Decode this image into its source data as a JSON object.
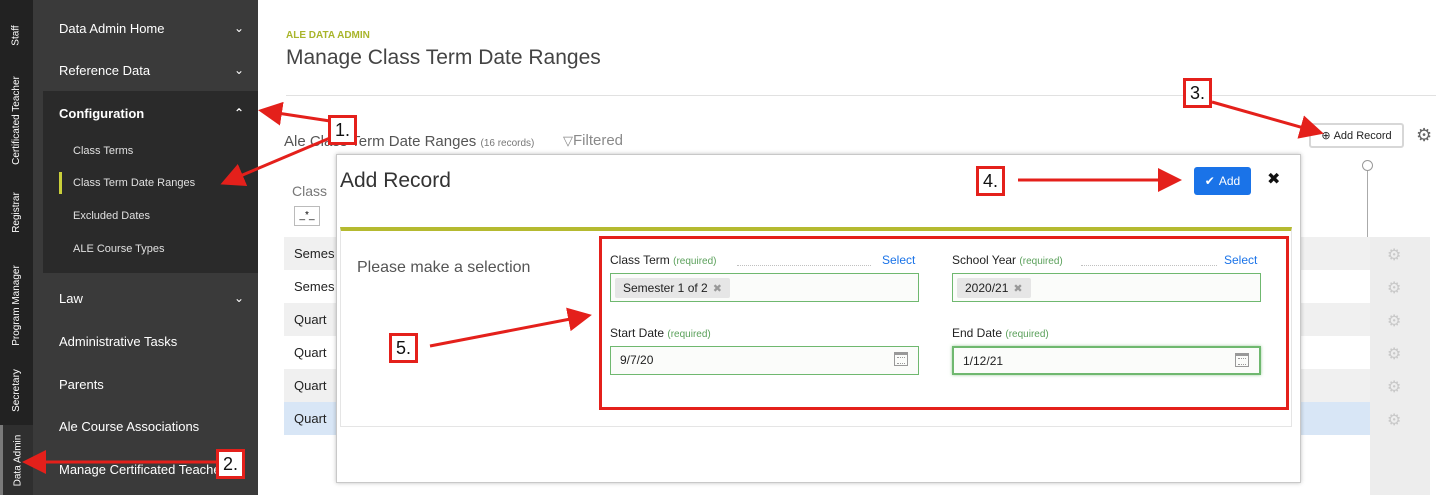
{
  "role_tabs": [
    {
      "label": "Staff",
      "active": false
    },
    {
      "label": "Certificated Teacher",
      "active": false
    },
    {
      "label": "Registrar",
      "active": false
    },
    {
      "label": "Program Manager",
      "active": false
    },
    {
      "label": "Secretary",
      "active": false
    },
    {
      "label": "Data Admin",
      "active": true
    }
  ],
  "sidebar": {
    "items": [
      {
        "label": "Data Admin Home",
        "chevron": "down"
      },
      {
        "label": "Reference Data",
        "chevron": "down"
      },
      {
        "label": "Configuration",
        "chevron": "up"
      },
      {
        "label": "Law",
        "chevron": "down"
      },
      {
        "label": "Administrative Tasks"
      },
      {
        "label": "Parents"
      },
      {
        "label": "Ale Course Associations"
      },
      {
        "label": "Manage Certificated Teache"
      }
    ],
    "sub_items": [
      {
        "label": "Class Terms"
      },
      {
        "label": "Class Term Date Ranges",
        "active": true
      },
      {
        "label": "Excluded Dates"
      },
      {
        "label": "ALE Course Types"
      }
    ]
  },
  "header": {
    "breadcrumb": "ALE DATA ADMIN",
    "title": "Manage Class Term Date Ranges"
  },
  "list": {
    "title": "Ale Class Term Date Ranges",
    "count": "(16 records)",
    "filtered": "Filtered",
    "add_record": "Add Record",
    "column_label": "Class",
    "filter_value": "_*_",
    "rows": [
      "Semes",
      "Semes",
      "Quart",
      "Quart",
      "Quart",
      "Quart"
    ]
  },
  "modal": {
    "title": "Add Record",
    "add_button": "Add",
    "selection_text": "Please make a selection",
    "fields": {
      "class_term": {
        "label": "Class Term",
        "required": "(required)",
        "select": "Select",
        "value": "Semester 1 of 2"
      },
      "school_year": {
        "label": "School Year",
        "required": "(required)",
        "select": "Select",
        "value": "2020/21"
      },
      "start_date": {
        "label": "Start Date",
        "required": "(required)",
        "value": "9/7/20"
      },
      "end_date": {
        "label": "End Date",
        "required": "(required)",
        "value": "1/12/21"
      }
    }
  },
  "annotations": [
    "1.",
    "2.",
    "3.",
    "4.",
    "5."
  ],
  "colors": {
    "accent": "#a9b52b",
    "primary": "#1a73e8",
    "annotation": "#e4201b",
    "sidebar": "#3a3a3a"
  }
}
